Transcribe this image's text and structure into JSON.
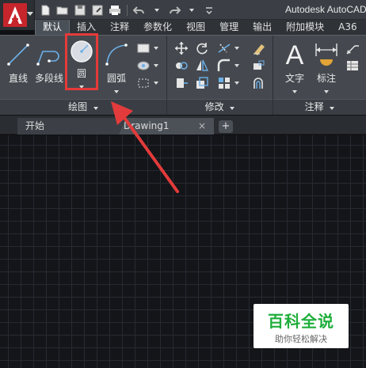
{
  "window": {
    "title": "Autodesk AutoCAD"
  },
  "ribbon_tabs": [
    {
      "label": "默认",
      "active": true
    },
    {
      "label": "插入"
    },
    {
      "label": "注释"
    },
    {
      "label": "参数化"
    },
    {
      "label": "视图"
    },
    {
      "label": "管理"
    },
    {
      "label": "输出"
    },
    {
      "label": "附加模块"
    },
    {
      "label": "A36"
    }
  ],
  "draw_panel": {
    "title": "绘图",
    "line_label": "直线",
    "polyline_label": "多段线",
    "circle_label": "圆",
    "arc_label": "圆弧"
  },
  "modify_panel": {
    "title": "修改"
  },
  "annotation_panel": {
    "title": "注释",
    "text_label": "文字",
    "dimension_label": "标注"
  },
  "file_tabs": {
    "start_label": "开始",
    "drawing_label": "Drawing1",
    "close_glyph": "×",
    "add_glyph": "+"
  },
  "watermark": {
    "main": "百科全说",
    "sub": "助你轻松解决"
  },
  "colors": {
    "accent_red": "#e53a3a",
    "watermark_green": "#1fae3b"
  }
}
